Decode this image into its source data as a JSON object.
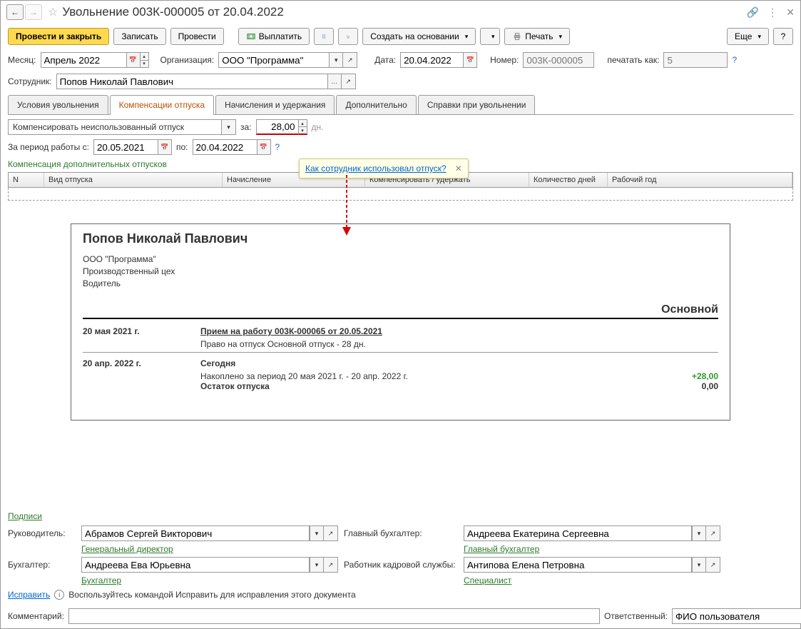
{
  "title": "Увольнение 003К-000005 от 20.04.2022",
  "toolbar": {
    "post_close": "Провести и закрыть",
    "save": "Записать",
    "post": "Провести",
    "payout": "Выплатить",
    "create_based": "Создать на основании",
    "print": "Печать",
    "more": "Еще"
  },
  "header": {
    "month_label": "Месяц:",
    "month_value": "Апрель 2022",
    "org_label": "Организация:",
    "org_value": "ООО \"Программа\"",
    "date_label": "Дата:",
    "date_value": "20.04.2022",
    "number_label": "Номер:",
    "number_value": "003К-000005",
    "print_as_label": "печатать как:",
    "print_as_value": "5",
    "employee_label": "Сотрудник:",
    "employee_value": "Попов Николай Павлович"
  },
  "tabs": [
    "Условия увольнения",
    "Компенсации отпуска",
    "Начисления и удержания",
    "Дополнительно",
    "Справки при увольнении"
  ],
  "compensation": {
    "mode": "Компенсировать неиспользованный отпуск",
    "for_label": "за:",
    "days_value": "28,00",
    "days_unit": "дн.",
    "period_label_from": "За период работы с:",
    "period_from": "20.05.2021",
    "period_label_to": "по:",
    "period_to": "20.04.2022",
    "tooltip_link": "Как сотрудник использовал отпуск?",
    "extra_heading": "Компенсация дополнительных отпусков",
    "grid_headers": [
      "N",
      "Вид отпуска",
      "Начисление",
      "Компенсировать / удержать",
      "Количество дней",
      "Рабочий год"
    ]
  },
  "report": {
    "name": "Попов Николай Павлович",
    "org": "ООО \"Программа\"",
    "dept": "Производственный цех",
    "position": "Водитель",
    "section": "Основной",
    "date1": "20 мая 2021 г.",
    "event1": "Прием на работу 003К-000065 от 20.05.2021",
    "desc1": "Право на отпуск Основной отпуск - 28 дн.",
    "date2": "20 апр. 2022 г.",
    "event2": "Сегодня",
    "desc2_label": "Накоплено за период 20 мая 2021 г. - 20 апр. 2022 г.",
    "desc2_value": "+28,00",
    "balance_label": "Остаток отпуска",
    "balance_value": "0,00"
  },
  "signatures": {
    "heading": "Подписи",
    "manager_label": "Руководитель:",
    "manager_value": "Абрамов Сергей Викторович",
    "manager_role": "Генеральный директор",
    "chief_acc_label": "Главный бухгалтер:",
    "chief_acc_value": "Андреева Екатерина Сергеевна",
    "chief_acc_role": "Главный бухгалтер",
    "acc_label": "Бухгалтер:",
    "acc_value": "Андреева Ева Юрьевна",
    "acc_role": "Бухгалтер",
    "hr_label": "Работник кадровой службы:",
    "hr_value": "Антипова Елена Петровна",
    "hr_role": "Специалист"
  },
  "fix": {
    "link": "Исправить",
    "hint": "Воспользуйтесь командой Исправить для исправления этого документа"
  },
  "footer": {
    "comment_label": "Комментарий:",
    "comment_value": "",
    "responsible_label": "Ответственный:",
    "responsible_value": "ФИО пользователя"
  }
}
